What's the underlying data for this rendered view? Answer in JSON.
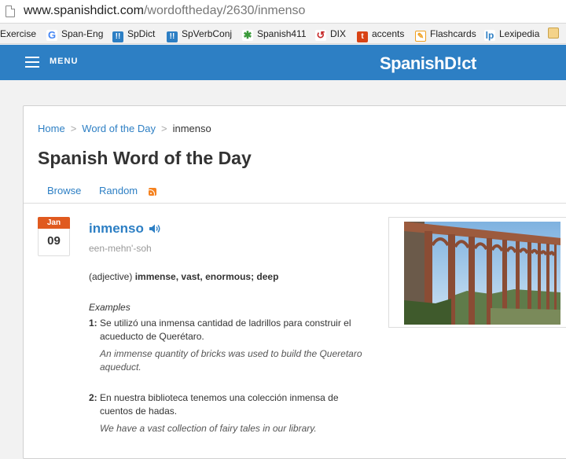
{
  "browser": {
    "url_host": "www.spanishdict.com",
    "url_path": "/wordoftheday/2630/inmenso"
  },
  "bookmarks": [
    {
      "label": "Exercise",
      "icon": "none"
    },
    {
      "label": "Span-Eng",
      "icon": "google-icon"
    },
    {
      "label": "SpDict",
      "icon": "spanishdict-icon"
    },
    {
      "label": "SpVerbConj",
      "icon": "spanishdict-icon"
    },
    {
      "label": "Spanish411",
      "icon": "spanish411-icon"
    },
    {
      "label": "DIX",
      "icon": "dix-icon"
    },
    {
      "label": "accents",
      "icon": "t-icon"
    },
    {
      "label": "Flashcards",
      "icon": "flashcards-icon"
    },
    {
      "label": "Lexipedia",
      "icon": "lp-icon"
    }
  ],
  "header": {
    "menu_label": "MENU",
    "logo": "SpanishD!ct"
  },
  "breadcrumb": {
    "home": "Home",
    "section": "Word of the Day",
    "current": "inmenso"
  },
  "page_title": "Spanish Word of the Day",
  "tabs": {
    "browse": "Browse",
    "random": "Random"
  },
  "entry": {
    "month": "Jan",
    "day": "09",
    "word": "inmenso",
    "pronunciation": "een-mehn'-soh",
    "part_of_speech": "(adjective)",
    "definition": "immense, vast, enormous; deep",
    "examples_label": "Examples",
    "examples": [
      {
        "num": "1:",
        "spanish": "Se utilizó una inmensa cantidad de ladrillos para construir el acueducto de Querétaro.",
        "english": "An immense quantity of bricks was used to build the Queretaro aqueduct."
      },
      {
        "num": "2:",
        "spanish": "En nuestra biblioteca tenemos una colección inmensa de cuentos de hadas.",
        "english": "We have a vast collection of fairy tales in our library."
      }
    ]
  },
  "colors": {
    "brand_blue": "#2d7fc4",
    "date_orange": "#e05a1f",
    "rss_orange": "#f58220"
  }
}
